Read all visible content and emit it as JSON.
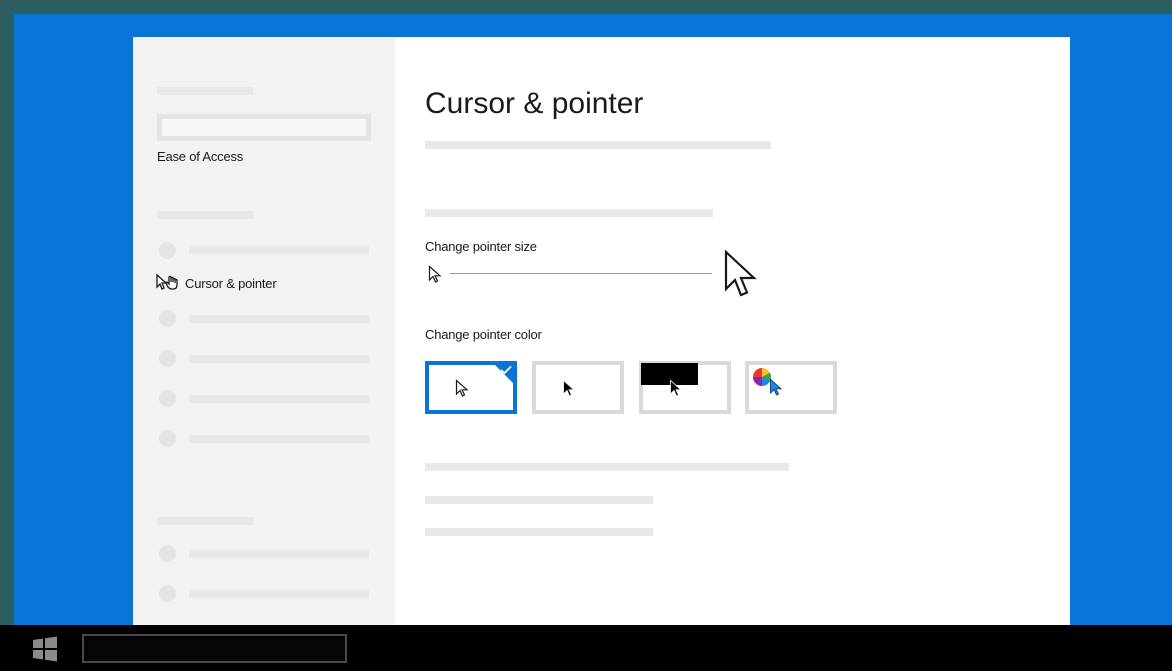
{
  "sidebar": {
    "section_label": "Ease of Access",
    "active_item_label": "Cursor & pointer"
  },
  "main": {
    "title": "Cursor & pointer",
    "size_label": "Change pointer size",
    "color_label": "Change pointer color",
    "pointer_colors": [
      {
        "name": "white",
        "selected": true
      },
      {
        "name": "black",
        "selected": false
      },
      {
        "name": "inverted",
        "selected": false
      },
      {
        "name": "custom",
        "selected": false
      }
    ]
  },
  "colors": {
    "accent": "#0a73d6",
    "desktop": "#0a73d6",
    "taskbar": "#000000"
  }
}
